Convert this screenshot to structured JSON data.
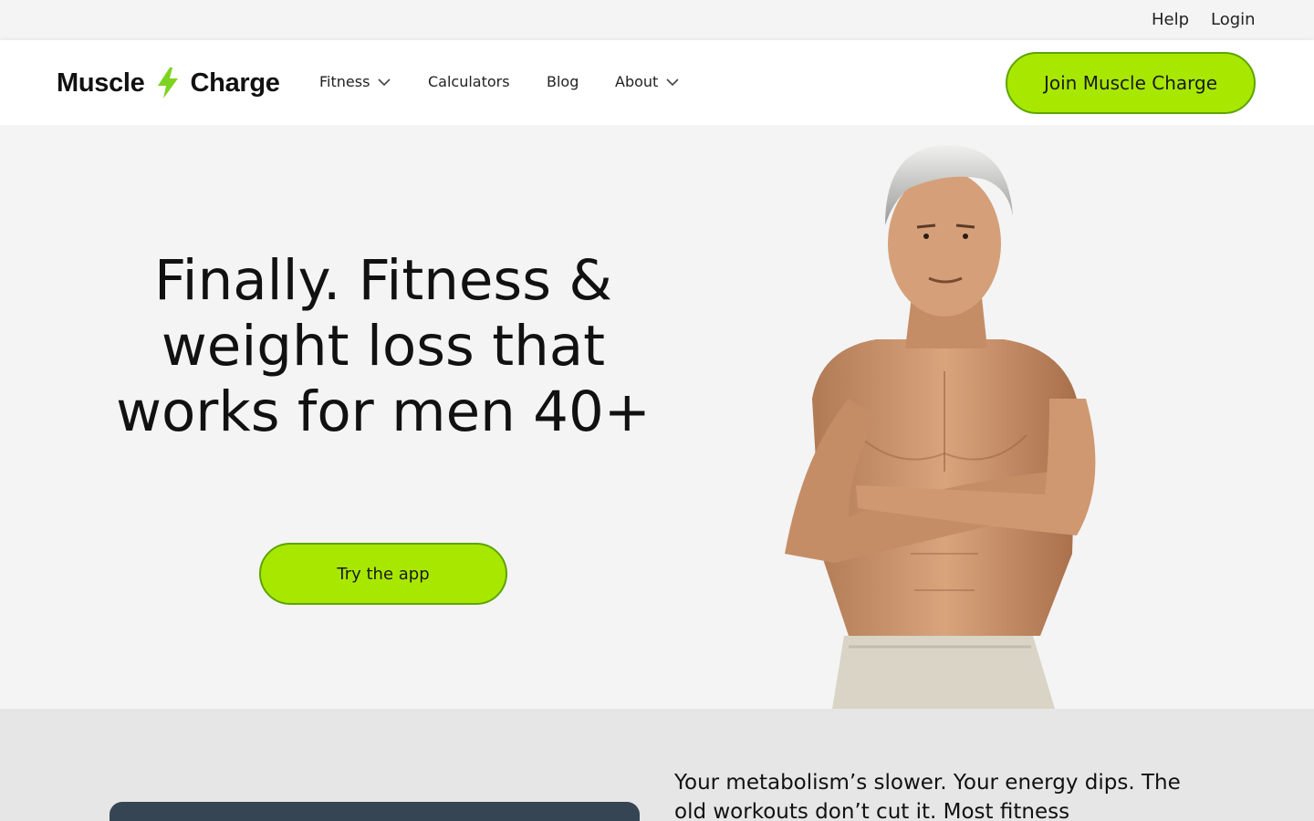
{
  "topbar": {
    "help": "Help",
    "login": "Login"
  },
  "logo": {
    "word1": "Muscle",
    "word2": "Charge",
    "icon": "lightning-bolt-icon"
  },
  "nav": {
    "items": [
      {
        "label": "Fitness",
        "has_dropdown": true
      },
      {
        "label": "Calculators",
        "has_dropdown": false
      },
      {
        "label": "Blog",
        "has_dropdown": false
      },
      {
        "label": "About",
        "has_dropdown": true
      }
    ],
    "cta": "Join Muscle Charge"
  },
  "hero": {
    "headline": "Finally. Fitness & weight loss that works for men 40+",
    "button": "Try the app",
    "image": "man-arms-crossed-image"
  },
  "section2": {
    "text": "Your metabolism’s slower. Your energy dips. The old workouts don’t cut it. Most fitness"
  },
  "colors": {
    "accent": "#a8e800",
    "accent_border": "#5da400",
    "card": "#364554",
    "hero_bg": "#f4f4f4",
    "section_bg": "#e6e6e6"
  }
}
